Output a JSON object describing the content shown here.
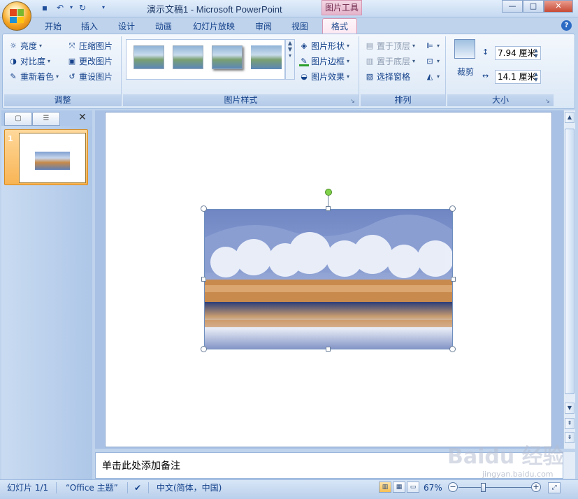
{
  "window": {
    "title": "演示文稿1 - Microsoft PowerPoint",
    "contextual_tool": "图片工具"
  },
  "tabs": [
    "开始",
    "插入",
    "设计",
    "动画",
    "幻灯片放映",
    "审阅",
    "视图",
    "格式"
  ],
  "ribbon": {
    "adjust": {
      "label": "调整",
      "brightness": "亮度",
      "contrast": "对比度",
      "recolor": "重新着色",
      "compress": "压缩图片",
      "change_picture": "更改图片",
      "reset_picture": "重设图片"
    },
    "picture_styles": {
      "label": "图片样式",
      "shape": "图片形状",
      "border": "图片边框",
      "effects": "图片效果"
    },
    "arrange": {
      "label": "排列",
      "bring_to_front": "置于顶层",
      "send_to_back": "置于底层",
      "selection_pane": "选择窗格"
    },
    "size": {
      "label": "大小",
      "crop": "裁剪",
      "height": "7.94 厘米",
      "width": "14.1 厘米"
    }
  },
  "slide_panel": {
    "slide_number": "1"
  },
  "notes": {
    "placeholder": "单击此处添加备注"
  },
  "statusbar": {
    "slide_info": "幻灯片 1/1",
    "theme": "“Office 主题”",
    "language": "中文(简体，中国)",
    "zoom": "67%"
  },
  "watermark": {
    "brand": "Baidu 经验",
    "url": "jingyan.baidu.com"
  },
  "colors": {
    "ribbon_bg": "#dae7f6",
    "contextual_tab": "#e5b4cb",
    "accent": "#15428b"
  }
}
